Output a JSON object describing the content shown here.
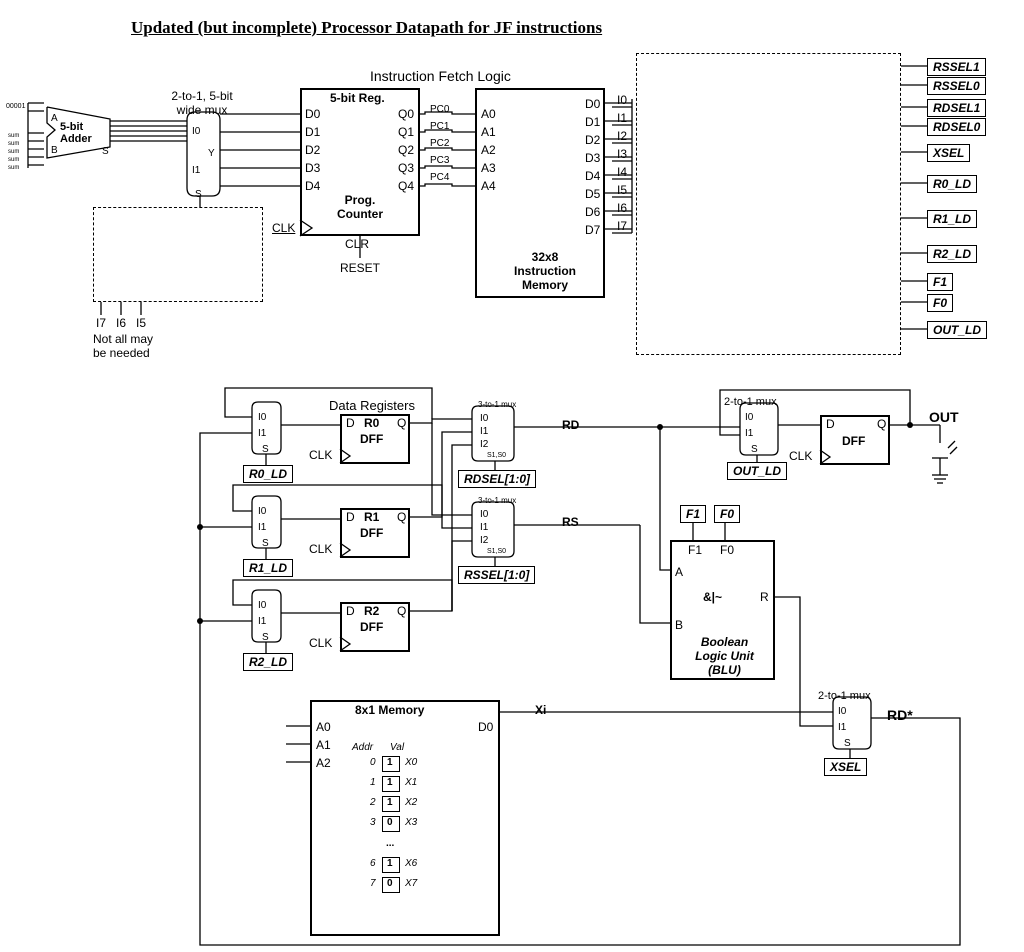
{
  "title": "Updated (but incomplete) Processor Datapath for JF instructions",
  "fetch_logic": "Instruction Fetch Logic",
  "mux5_caption": "2-to-1, 5-bit\nwide mux",
  "adder": {
    "name": "5-bit\nAdder",
    "A": "A",
    "B": "B",
    "S": "S"
  },
  "mux5": {
    "I0": "I0",
    "I1": "I1",
    "Y": "Y",
    "S": "S"
  },
  "reg5": {
    "name": "5-bit Reg.",
    "D": [
      "D0",
      "D1",
      "D2",
      "D3",
      "D4"
    ],
    "Q": [
      "Q0",
      "Q1",
      "Q2",
      "Q3",
      "Q4"
    ],
    "PC": [
      "PC0",
      "PC1",
      "PC2",
      "PC3",
      "PC4"
    ],
    "prog": "Prog.\nCounter",
    "CLK": "CLK",
    "CLR": "CLR",
    "RESET": "RESET"
  },
  "imem": {
    "A": [
      "A0",
      "A1",
      "A2",
      "A3",
      "A4"
    ],
    "D": [
      "D0",
      "D1",
      "D2",
      "D3",
      "D4",
      "D5",
      "D6",
      "D7"
    ],
    "I": [
      "I0",
      "I1",
      "I2",
      "I3",
      "I4",
      "I5",
      "I6",
      "I7"
    ],
    "name": "32x8\nInstruction\nMemory"
  },
  "dashed_note_bits": [
    "I7",
    "I6",
    "I5"
  ],
  "dashed_note": "Not all may\nbe needed",
  "control_box_right": {
    "signals": [
      "RSSEL1",
      "RSSEL0",
      "RDSEL1",
      "RDSEL0",
      "XSEL",
      "R0_LD",
      "R1_LD",
      "R2_LD",
      "F1",
      "F0",
      "OUT_LD"
    ]
  },
  "data_regs": {
    "label": "Data Registers",
    "items": [
      {
        "name": "R0",
        "ld": "R0_LD"
      },
      {
        "name": "R1",
        "ld": "R1_LD"
      },
      {
        "name": "R2",
        "ld": "R2_LD"
      }
    ],
    "DFF": "DFF",
    "D": "D",
    "Q": "Q",
    "CLK": "CLK",
    "mux_in": [
      "I0",
      "I1",
      "S"
    ]
  },
  "rd_mux": {
    "caption": "3-to-1 mux",
    "I": [
      "I0",
      "I1",
      "I2"
    ],
    "sel": "S1,S0",
    "ctrl": "RDSEL[1:0]",
    "RD": "RD"
  },
  "rs_mux": {
    "caption": "3-to-1 mux",
    "I": [
      "I0",
      "I1",
      "I2"
    ],
    "sel": "S1,S0",
    "ctrl": "RSSEL[1:0]",
    "RS": "RS"
  },
  "out_mux": {
    "caption": "2-to-1 mux",
    "I": [
      "I0",
      "I1"
    ],
    "S": "S",
    "ctrl": "OUT_LD",
    "OUT": "OUT"
  },
  "out_dff": {
    "D": "D",
    "Q": "Q",
    "DFF": "DFF",
    "CLK": "CLK"
  },
  "blu": {
    "F1": "F1",
    "F0": "F0",
    "A": "A",
    "B": "B",
    "R": "R",
    "op": "&|~",
    "name": "Boolean\nLogic Unit\n(BLU)"
  },
  "xsel_mux": {
    "caption": "2-to-1 mux",
    "I": [
      "I0",
      "I1"
    ],
    "S": "S",
    "ctrl": "XSEL",
    "RDstar": "RD*"
  },
  "mem8x1": {
    "name": "8x1 Memory",
    "A": [
      "A0",
      "A1",
      "A2"
    ],
    "D0": "D0",
    "Xi": "Xi",
    "hdr_addr": "Addr",
    "hdr_val": "Val",
    "rows": [
      {
        "a": "0",
        "v": "1",
        "x": "X0"
      },
      {
        "a": "1",
        "v": "1",
        "x": "X1"
      },
      {
        "a": "2",
        "v": "1",
        "x": "X2"
      },
      {
        "a": "3",
        "v": "0",
        "x": "X3"
      }
    ],
    "dots": "...",
    "rows2": [
      {
        "a": "6",
        "v": "1",
        "x": "X6"
      },
      {
        "a": "7",
        "v": "0",
        "x": "X7"
      }
    ]
  },
  "tiny_labels_left": [
    "00001",
    "sum",
    "sum",
    "sum",
    "sum",
    "sum"
  ]
}
